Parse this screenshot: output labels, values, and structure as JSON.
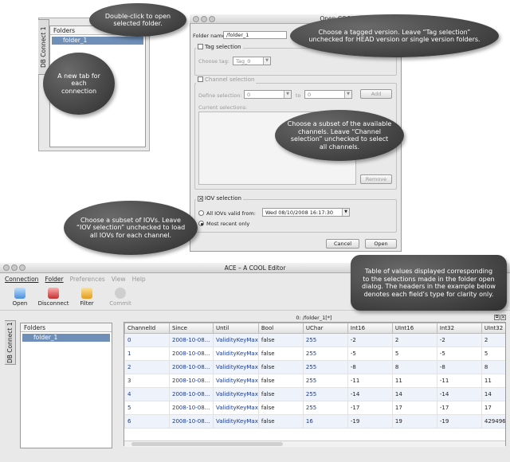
{
  "top_panel": {
    "tab": "DB Connect 1",
    "tree_header": "Folders",
    "tree_item": "folder_1"
  },
  "dialog": {
    "title": "Open COOL Folder",
    "folder_name_label": "Folder name:",
    "folder_name_value": "/folder_1",
    "tag_selection_label": "Tag selection",
    "choose_tag_label": "Choose tag:",
    "choose_tag_value": "Tag_0",
    "channel_selection_label": "Channel selection",
    "define_selection_label": "Define selection:",
    "range_from": "0",
    "range_to_label": "to",
    "range_to": "0",
    "add_label": "Add",
    "current_selections_label": "Current selections:",
    "remove_label": "Remove",
    "iov_selection_label": "IOV selection",
    "all_iovs_label": "All IOVs valid from:",
    "iov_date": "Wed 08/10/2008 16:17:30",
    "most_recent_label": "Most recent only",
    "cancel_label": "Cancel",
    "open_label": "Open"
  },
  "callouts": {
    "dblclick": "Double-click to open selected folder.",
    "newtab": "A new tab for each connection",
    "tag": "Choose a tagged version. Leave “Tag selection” unchecked for HEAD version or single version folders.",
    "channels": "Choose a subset of the available channels. Leave “Channel selection” unchecked to select all channels.",
    "iov": "Choose a subset of IOVs. Leave “IOV selection” unchecked to load all IOVs for each channel.",
    "table": "Table of values displayed corresponding to the selections made in the folder open dialog. The headers in the example below denotes each field’s type for clarity only."
  },
  "ace": {
    "title": "ACE – A COOL Editor",
    "menu": [
      "Connection",
      "Folder",
      "Preferences",
      "View",
      "Help"
    ],
    "toolbar": [
      "Open",
      "Disconnect",
      "Filter",
      "Commit"
    ],
    "tab": "DB Connect 1",
    "tree_header": "Folders",
    "tree_item": "folder_1",
    "table_title": "0: /folder_1[*]",
    "columns": [
      "ChannelId",
      "Since",
      "Until",
      "Bool",
      "UChar",
      "Int16",
      "UInt16",
      "Int32",
      "UInt32"
    ],
    "rows": [
      [
        "0",
        "2008-10-08...",
        "ValidityKeyMax",
        "false",
        "255",
        "-2",
        "2",
        "-2",
        "2"
      ],
      [
        "1",
        "2008-10-08...",
        "ValidityKeyMax",
        "false",
        "255",
        "-5",
        "5",
        "-5",
        "5"
      ],
      [
        "2",
        "2008-10-08...",
        "ValidityKeyMax",
        "false",
        "255",
        "-8",
        "8",
        "-8",
        "8"
      ],
      [
        "3",
        "2008-10-08...",
        "ValidityKeyMax",
        "false",
        "255",
        "-11",
        "11",
        "-11",
        "11"
      ],
      [
        "4",
        "2008-10-08...",
        "ValidityKeyMax",
        "false",
        "255",
        "-14",
        "14",
        "-14",
        "14"
      ],
      [
        "5",
        "2008-10-08...",
        "ValidityKeyMax",
        "false",
        "255",
        "-17",
        "17",
        "-17",
        "17"
      ],
      [
        "6",
        "2008-10-08...",
        "ValidityKeyMax",
        "false",
        "16",
        "-19",
        "19",
        "-19",
        "4294967"
      ]
    ]
  }
}
